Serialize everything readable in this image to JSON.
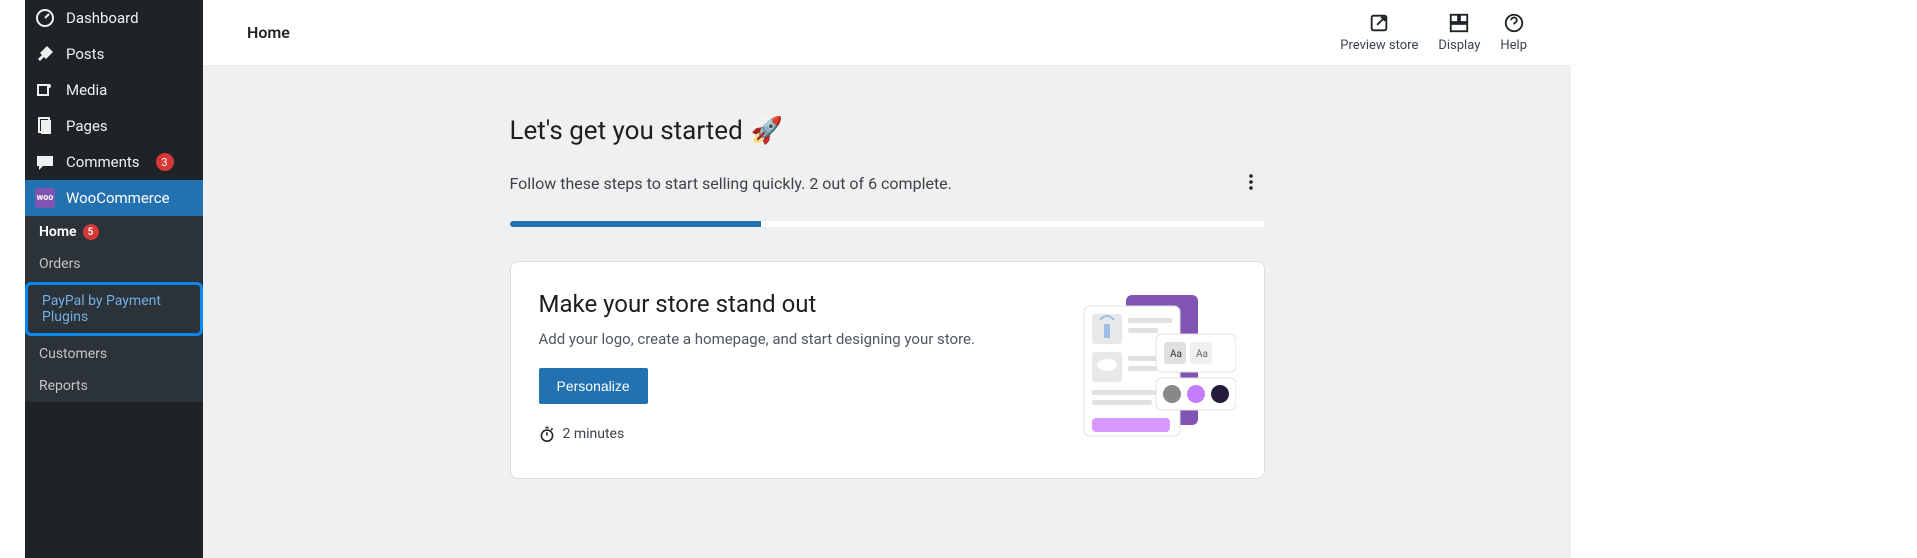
{
  "sidebar": {
    "items": [
      {
        "label": "Dashboard"
      },
      {
        "label": "Posts"
      },
      {
        "label": "Media"
      },
      {
        "label": "Pages"
      },
      {
        "label": "Comments",
        "badge": "3"
      },
      {
        "label": "WooCommerce"
      }
    ],
    "submenu": [
      {
        "label": "Home",
        "badge": "5"
      },
      {
        "label": "Orders"
      },
      {
        "label": "PayPal by Payment Plugins"
      },
      {
        "label": "Customers"
      },
      {
        "label": "Reports"
      }
    ]
  },
  "topbar": {
    "title": "Home",
    "actions": [
      {
        "label": "Preview store"
      },
      {
        "label": "Display"
      },
      {
        "label": "Help"
      }
    ]
  },
  "content": {
    "headline": "Let's get you started",
    "rocket": "🚀",
    "subline": "Follow these steps to start selling quickly. 2 out of 6 complete.",
    "progress_percent": 33.33,
    "card": {
      "title": "Make your store stand out",
      "desc": "Add your logo, create a homepage, and start designing your store.",
      "button": "Personalize",
      "time": "2 minutes"
    }
  }
}
